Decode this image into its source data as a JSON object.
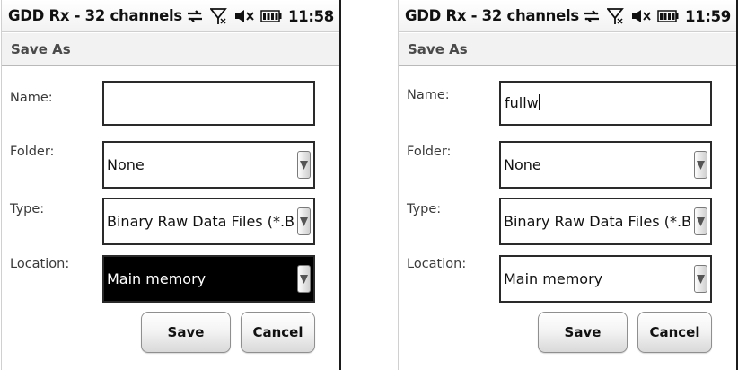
{
  "screens": [
    {
      "app_title": "GDD Rx - 32 channels",
      "clock": "11:58",
      "page_title": "Save As",
      "fields": {
        "name": {
          "label": "Name:",
          "value": ""
        },
        "folder": {
          "label": "Folder:",
          "value": "None"
        },
        "type": {
          "label": "Type:",
          "value": "Binary Raw Data Files (*.BD"
        },
        "location": {
          "label": "Location:",
          "value": "Main memory",
          "highlighted": true
        }
      },
      "buttons": {
        "save": "Save",
        "cancel": "Cancel"
      }
    },
    {
      "app_title": "GDD Rx - 32 channels",
      "clock": "11:59",
      "page_title": "Save As",
      "fields": {
        "name": {
          "label": "Name:",
          "value": "fullw"
        },
        "folder": {
          "label": "Folder:",
          "value": "None"
        },
        "type": {
          "label": "Type:",
          "value": "Binary Raw Data Files (*.BD"
        },
        "location": {
          "label": "Location:",
          "value": "Main memory",
          "highlighted": false
        }
      },
      "buttons": {
        "save": "Save",
        "cancel": "Cancel"
      }
    }
  ],
  "icons": [
    "connectivity-icon",
    "no-signal-icon",
    "speaker-muted-icon",
    "battery-icon",
    "dropdown-arrow-icon"
  ],
  "colors": {
    "selection": "#000000",
    "selected_text": "#ffffff",
    "header_bg": "#f2f2f2"
  }
}
